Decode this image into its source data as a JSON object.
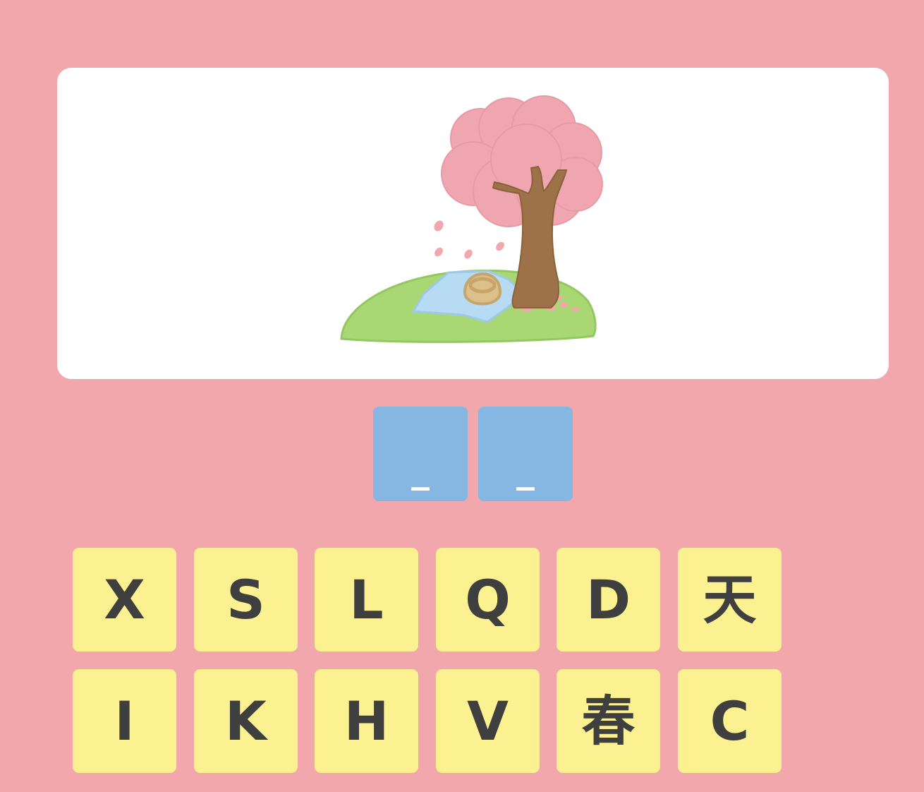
{
  "background_color": "#f2a7ad",
  "picture": {
    "icon": "cherry-blossom-picnic-illustration"
  },
  "answer": {
    "slots": [
      "_",
      "_"
    ],
    "slot_color": "#85b7e2"
  },
  "letters": {
    "tile_color": "#fcf190",
    "text_color": "#3f3f3f",
    "row1": [
      "X",
      "S",
      "L",
      "Q",
      "D",
      "天"
    ],
    "row2": [
      "I",
      "K",
      "H",
      "V",
      "春",
      "C"
    ]
  }
}
